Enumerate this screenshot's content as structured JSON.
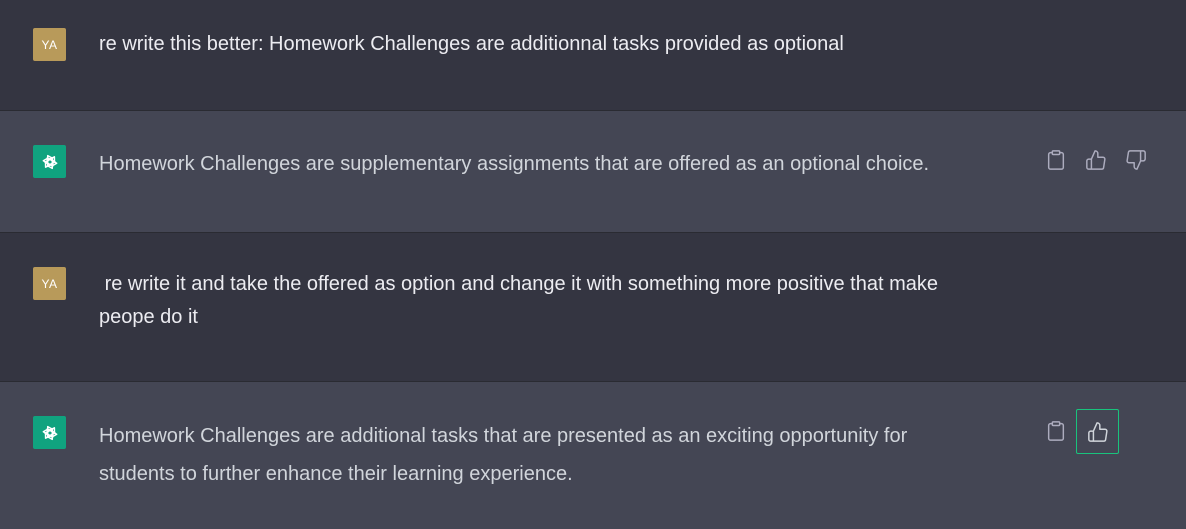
{
  "colors": {
    "user_row_bg": "#343541",
    "assistant_row_bg": "#444654",
    "user_avatar_bg": "#b89a5a",
    "assistant_avatar_bg": "#10a37f",
    "active_feedback_border": "#19c37d"
  },
  "messages": [
    {
      "role": "user",
      "avatar_label": "YA",
      "text": "re write this better: Homework Challenges are additionnal tasks provided as optional"
    },
    {
      "role": "assistant",
      "avatar_icon": "openai-logo-icon",
      "text": "Homework Challenges are supplementary assignments that are offered as an optional choice.",
      "actions": [
        "copy-icon",
        "thumbs-up-icon",
        "thumbs-down-icon"
      ]
    },
    {
      "role": "user",
      "avatar_label": "YA",
      "text": " re write it and take the offered as option and change it with something more positive that make\npeope do it"
    },
    {
      "role": "assistant",
      "avatar_icon": "openai-logo-icon",
      "text": "Homework Challenges are additional tasks that are presented as an exciting opportunity for\nstudents to further enhance their learning experience.",
      "actions": [
        "copy-icon",
        "thumbs-up-icon"
      ],
      "selected_feedback": "thumbs-up"
    }
  ]
}
